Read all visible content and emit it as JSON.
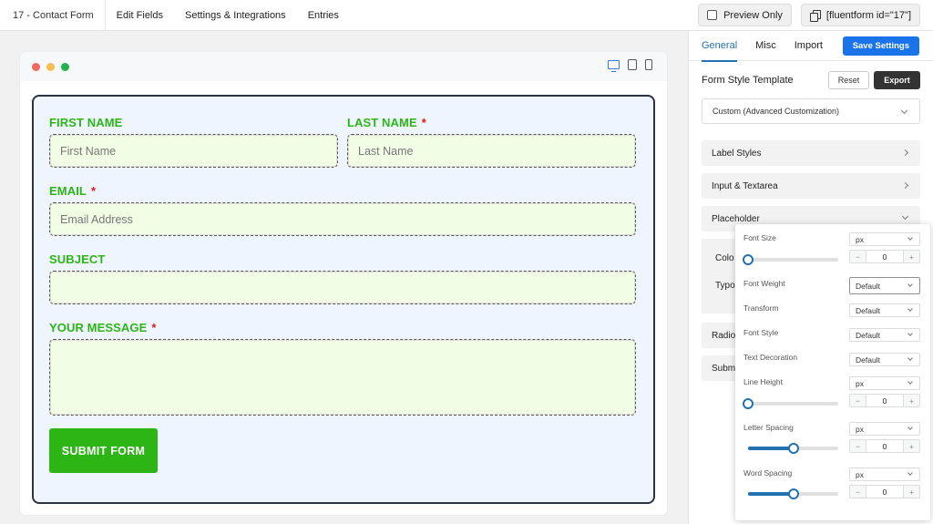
{
  "topbar": {
    "form_title": "17 - Contact Form",
    "nav": [
      "Edit Fields",
      "Settings & Integrations",
      "Entries"
    ],
    "preview_only": "Preview Only",
    "shortcode": "[fluentform id=\"17\"]"
  },
  "form": {
    "first_name_label": "FIRST NAME",
    "first_name_placeholder": "First Name",
    "last_name_label": "LAST NAME",
    "last_name_placeholder": "Last Name",
    "email_label": "EMAIL",
    "email_placeholder": "Email Address",
    "subject_label": "SUBJECT",
    "message_label": "YOUR MESSAGE",
    "required_mark": "*",
    "submit_label": "SUBMIT FORM"
  },
  "panel": {
    "tabs": [
      "General",
      "Misc",
      "Import"
    ],
    "save_label": "Save Settings",
    "style_template_label": "Form Style Template",
    "reset_label": "Reset",
    "export_label": "Export",
    "template_value": "Custom (Advanced Customization)",
    "sections": [
      "Label Styles",
      "Input & Textarea",
      "Placeholder"
    ],
    "sub_color": "Colo",
    "sub_typo": "Typo",
    "radio_cut": "Radio",
    "submit_cut": "Subm"
  },
  "popup": {
    "font_size_label": "Font Size",
    "font_size_unit": "px",
    "font_size_value": "0",
    "font_size_fraction": 0,
    "font_weight_label": "Font Weight",
    "font_weight_value": "Default",
    "transform_label": "Transform",
    "transform_value": "Default",
    "font_style_label": "Font Style",
    "font_style_value": "Default",
    "text_decoration_label": "Text Decoration",
    "text_decoration_value": "Default",
    "line_height_label": "Line Height",
    "line_height_unit": "px",
    "line_height_value": "0",
    "line_height_fraction": 0,
    "letter_spacing_label": "Letter Spacing",
    "letter_spacing_unit": "px",
    "letter_spacing_value": "0",
    "letter_spacing_fraction": 0.5,
    "word_spacing_label": "Word Spacing",
    "word_spacing_unit": "px",
    "word_spacing_value": "0",
    "word_spacing_fraction": 0.5,
    "minus": "−",
    "plus": "+"
  },
  "colors": {
    "accent": "#2271b1",
    "label_green": "#2db516",
    "required_red": "#d91c1c",
    "input_bg": "#f2fde5",
    "form_bg": "#eef5ff"
  }
}
